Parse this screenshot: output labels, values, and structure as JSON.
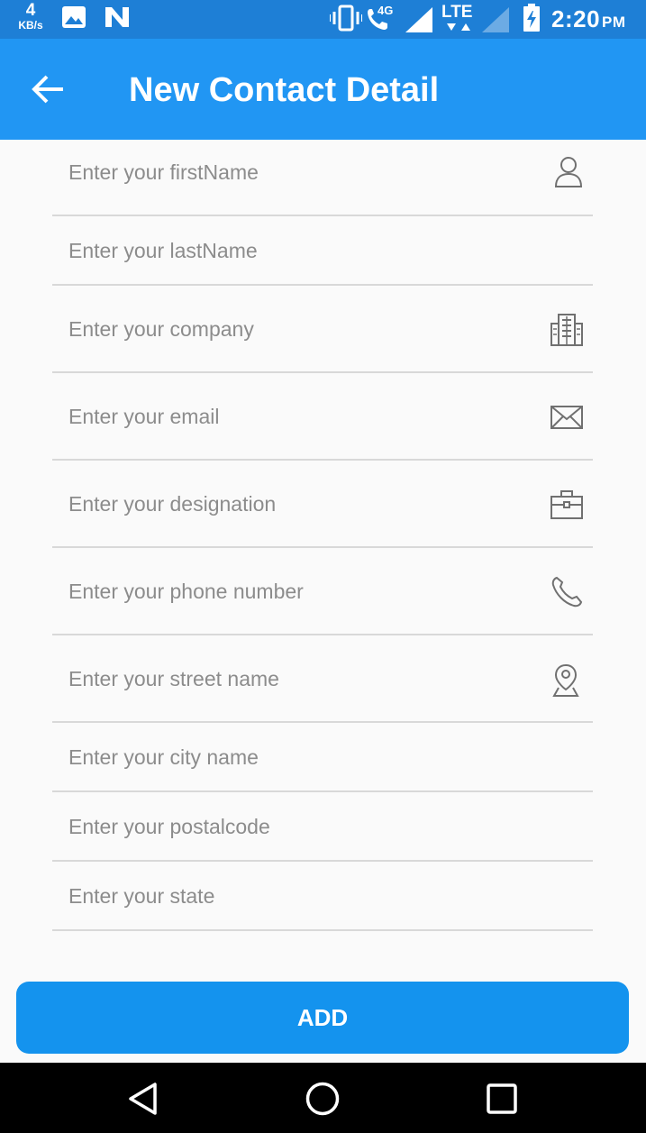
{
  "status_bar": {
    "speed_value": "4",
    "speed_unit": "KB/s",
    "network_4g": "4G",
    "network_lte": "LTE",
    "time": "2:20",
    "ampm": "PM"
  },
  "app_bar": {
    "title": "New Contact Detail"
  },
  "form": {
    "fields": [
      {
        "placeholder": "Enter your firstName",
        "icon": "person-icon"
      },
      {
        "placeholder": "Enter your lastName",
        "icon": ""
      },
      {
        "placeholder": "Enter your company",
        "icon": "building-icon"
      },
      {
        "placeholder": "Enter your email",
        "icon": "mail-icon"
      },
      {
        "placeholder": "Enter your designation",
        "icon": "briefcase-icon"
      },
      {
        "placeholder": "Enter your phone number",
        "icon": "phone-icon"
      },
      {
        "placeholder": "Enter your street name",
        "icon": "location-pin-icon"
      },
      {
        "placeholder": "Enter your city name",
        "icon": ""
      },
      {
        "placeholder": "Enter your postalcode",
        "icon": ""
      },
      {
        "placeholder": "Enter your state",
        "icon": ""
      }
    ]
  },
  "actions": {
    "add_label": "ADD"
  },
  "colors": {
    "status_bar": "#1e7fd6",
    "app_bar": "#2196f3",
    "add_button": "#1493ee",
    "placeholder_text": "#8c8c8c",
    "divider": "#d8d8d8"
  }
}
